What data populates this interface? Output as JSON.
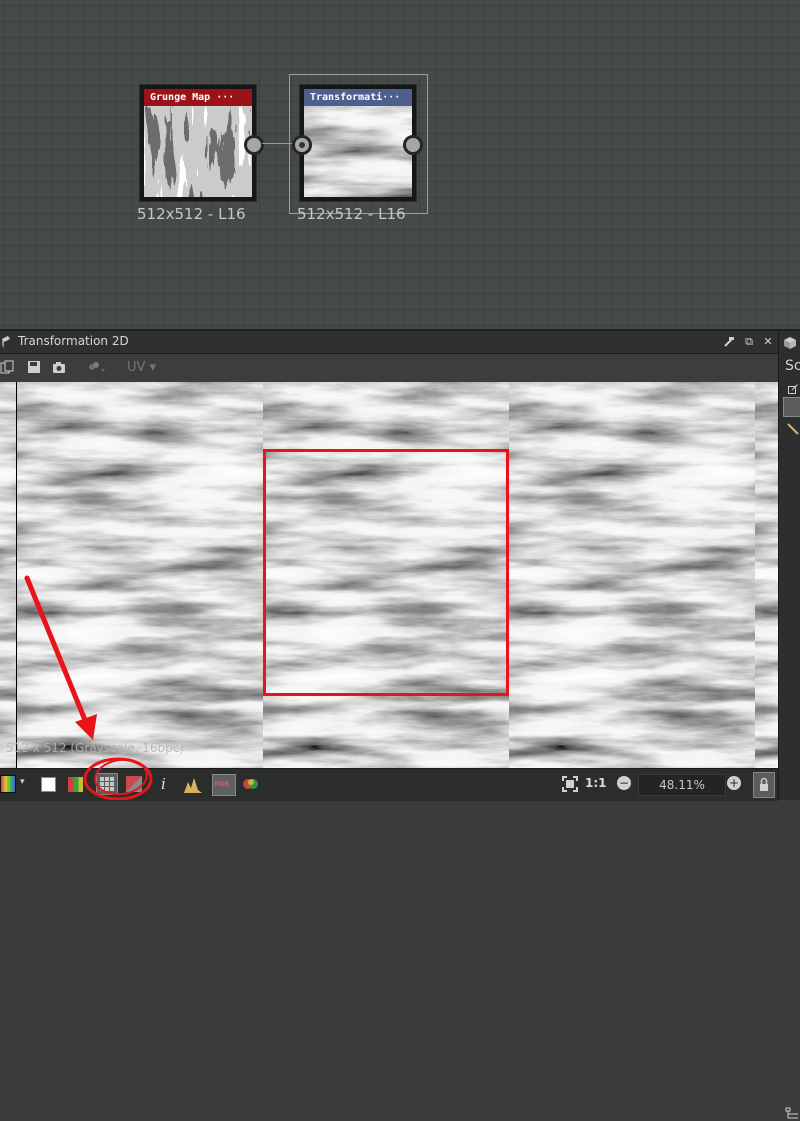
{
  "graph": {
    "nodes": [
      {
        "title": "Grunge Map ···",
        "header_color": "#9b1218",
        "resolution_label": "512x512 - L16"
      },
      {
        "title": "Transformati···",
        "header_color": "#4e5f8e",
        "resolution_label": "512x512 - L16"
      }
    ]
  },
  "panel": {
    "title": "Transformation 2D",
    "pin_label": "✕",
    "float_label": "⧉",
    "close_label": "✕"
  },
  "toolbar": {
    "uv_label": "UV ▾"
  },
  "viewport": {
    "info_text": "512 x 512 (Grayscale, 16bpc)"
  },
  "bottombar": {
    "ratio_label": "1:1",
    "zoom_value": "48.11%",
    "minus_label": "−",
    "plus_label": "+",
    "info_label": "i",
    "rgb_label": "RGB"
  },
  "side_panel": {
    "label": "Sc"
  },
  "colors": {
    "annotation_red": "#e8141a",
    "graph_bg": "#464a48",
    "panel_bg": "#2f3131"
  }
}
